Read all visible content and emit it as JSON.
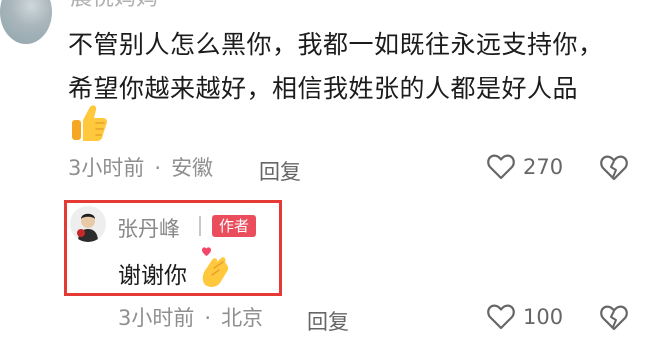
{
  "top_comment": {
    "username": "晨悦妈妈",
    "text_line1": "不管别人怎么黑你，我都一如既往永远支持你，",
    "text_line2": "希望你越来越好，相信我姓张的人都是好人品",
    "emoji": "thumbs-up",
    "time": "3小时前",
    "separator": "·",
    "location": "安徽",
    "reply_label": "回复",
    "likes": "270"
  },
  "author_reply": {
    "name": "张丹峰",
    "badge": "作者",
    "text": "谢谢你",
    "emoji": "finger-heart",
    "time": "3小时前",
    "separator": "·",
    "location": "北京",
    "reply_label": "回复",
    "likes": "100",
    "highlight_color": "#e53935"
  },
  "icons": {
    "like": "heart-outline-icon",
    "dislike": "broken-heart-icon"
  },
  "colors": {
    "badge": "#ea4e5d",
    "text": "#1c1c1c",
    "meta": "#8f8f8f"
  }
}
